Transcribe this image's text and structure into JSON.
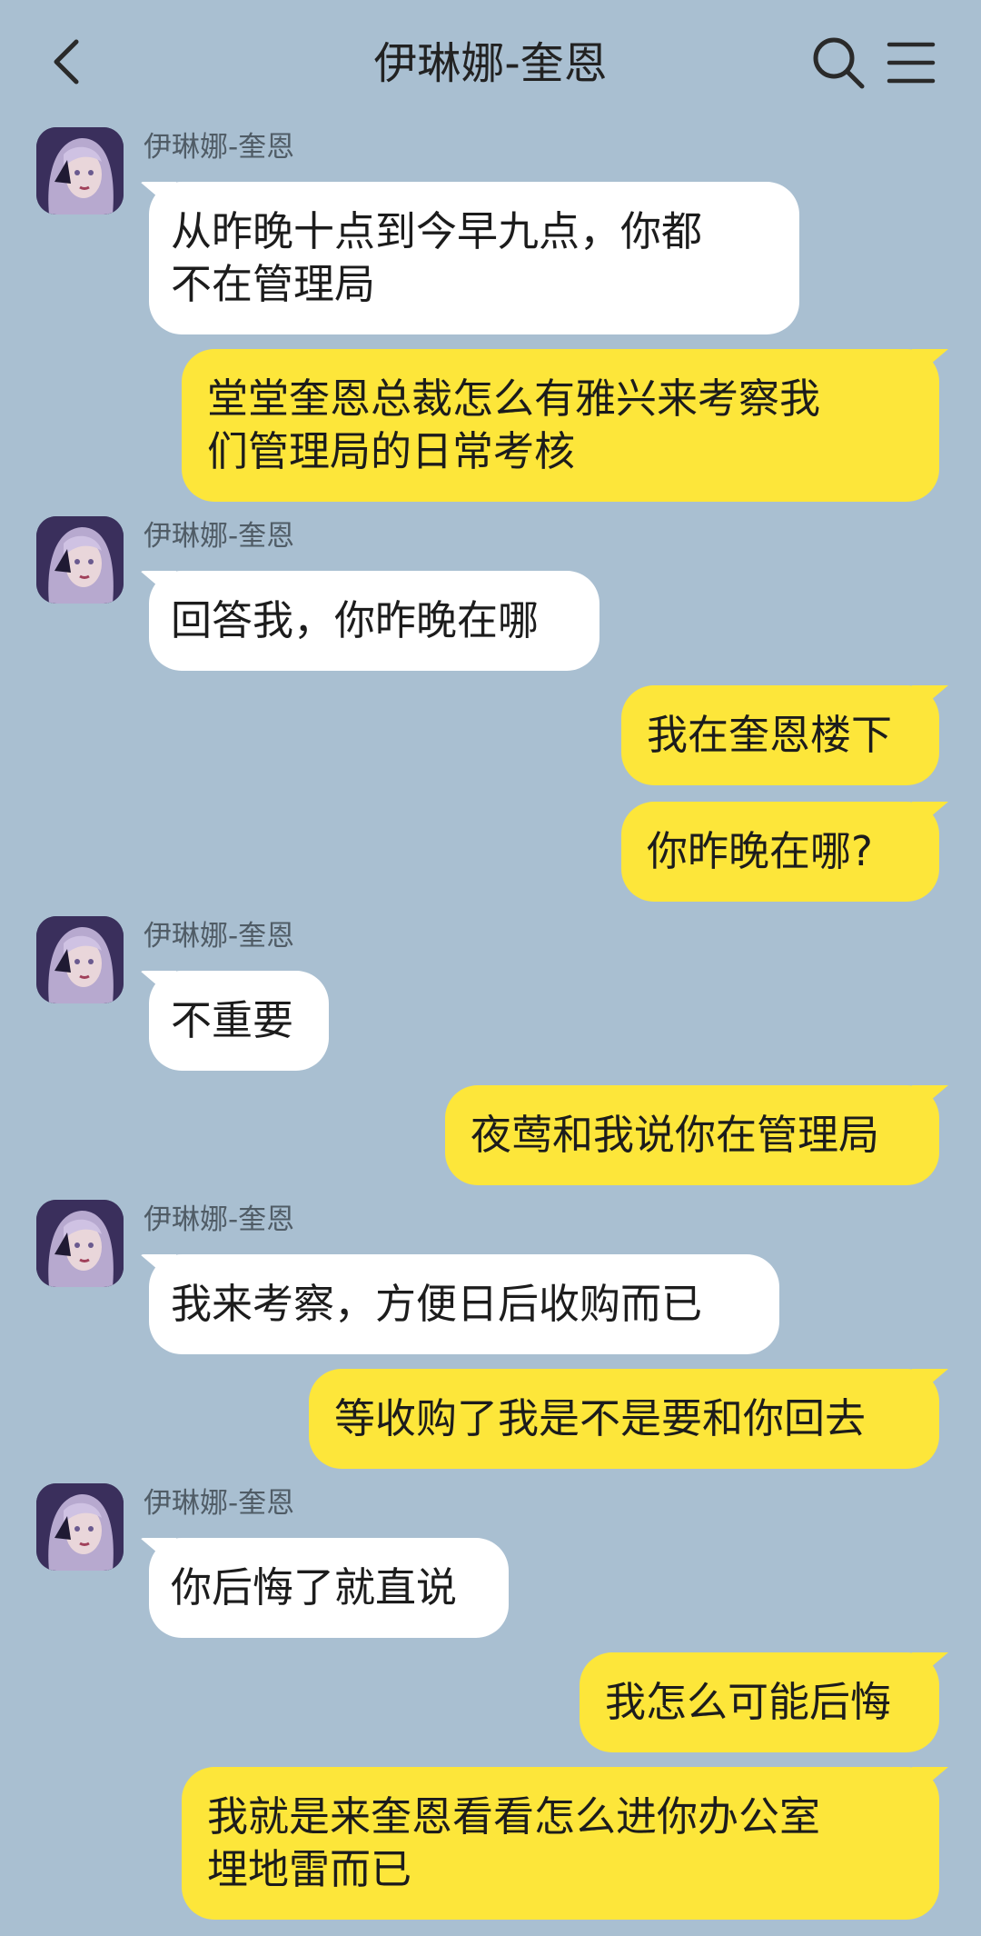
{
  "header": {
    "title": "伊琳娜-奎恩",
    "back_icon": "chevron-left-icon",
    "search_icon": "search-icon",
    "menu_icon": "hamburger-menu-icon"
  },
  "colors": {
    "background": "#a9bfd1",
    "incoming_bubble": "#ffffff",
    "outgoing_bubble": "#fde63a"
  },
  "messages": [
    {
      "from": "them",
      "sender": "伊琳娜-奎恩",
      "text": "从昨晚十点到今早九点，你都\n不在管理局"
    },
    {
      "from": "me",
      "text": "堂堂奎恩总裁怎么有雅兴来考察我\n们管理局的日常考核"
    },
    {
      "from": "them",
      "sender": "伊琳娜-奎恩",
      "text": "回答我，你昨晚在哪"
    },
    {
      "from": "me",
      "text": "我在奎恩楼下"
    },
    {
      "from": "me",
      "text": "你昨晚在哪?"
    },
    {
      "from": "them",
      "sender": "伊琳娜-奎恩",
      "text": "不重要"
    },
    {
      "from": "me",
      "text": "夜莺和我说你在管理局"
    },
    {
      "from": "them",
      "sender": "伊琳娜-奎恩",
      "text": "我来考察，方便日后收购而已"
    },
    {
      "from": "me",
      "text": "等收购了我是不是要和你回去"
    },
    {
      "from": "them",
      "sender": "伊琳娜-奎恩",
      "text": "你后悔了就直说"
    },
    {
      "from": "me",
      "text": "我怎么可能后悔"
    },
    {
      "from": "me",
      "text": "我就是来奎恩看看怎么进你办公室\n埋地雷而已"
    }
  ]
}
